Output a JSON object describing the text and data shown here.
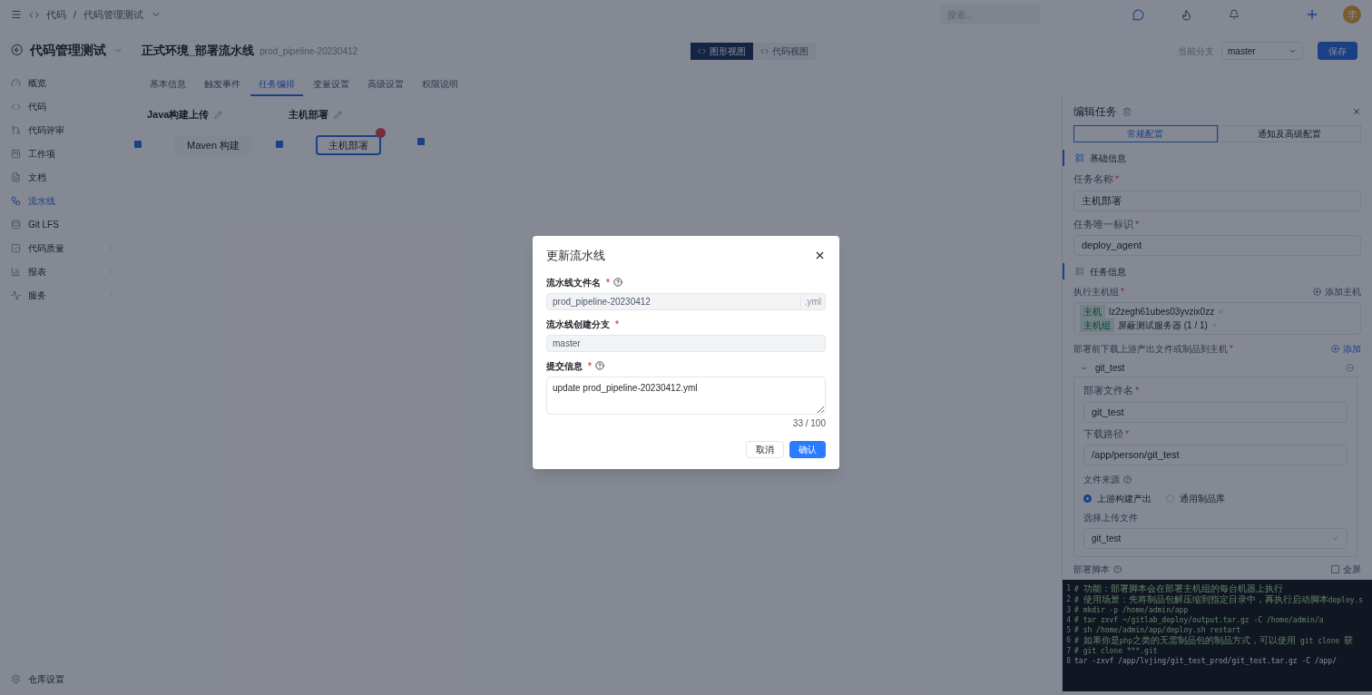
{
  "required_mark": "*",
  "topbar": {
    "breadcrumb": [
      "代码",
      "代码管理测试"
    ],
    "separator": "/",
    "search": {
      "placeholder": "搜索..."
    },
    "avatar": "李"
  },
  "sidebar": {
    "title": "代码管理测试",
    "items": [
      {
        "label": "概览",
        "kind": "overview",
        "selected": false,
        "expandable": false
      },
      {
        "label": "代码",
        "kind": "code",
        "selected": false,
        "expandable": false
      },
      {
        "label": "代码评审",
        "kind": "review",
        "selected": false,
        "expandable": false
      },
      {
        "label": "工作项",
        "kind": "work",
        "selected": false,
        "expandable": false
      },
      {
        "label": "文档",
        "kind": "doc",
        "selected": false,
        "expandable": false
      },
      {
        "label": "流水线",
        "kind": "pipeline",
        "selected": true,
        "expandable": false
      },
      {
        "label": "Git LFS",
        "kind": "lfs",
        "selected": false,
        "expandable": false
      },
      {
        "label": "代码质量",
        "kind": "quality",
        "selected": false,
        "expandable": true
      },
      {
        "label": "报表",
        "kind": "report",
        "selected": false,
        "expandable": true
      },
      {
        "label": "服务",
        "kind": "service",
        "selected": false,
        "expandable": true
      }
    ],
    "footer": "仓库设置"
  },
  "header": {
    "title": "正式环境_部署流水线",
    "subtitle": "prod_pipeline-20230412",
    "views": [
      {
        "label": "图形视图",
        "selected": true
      },
      {
        "label": "代码视图",
        "selected": false
      }
    ],
    "branch_label": "当前分支",
    "branch": "master",
    "save": "保存"
  },
  "tabs": [
    {
      "label": "基本信息",
      "selected": false
    },
    {
      "label": "触发事件",
      "selected": false
    },
    {
      "label": "任务编排",
      "selected": true
    },
    {
      "label": "变量设置",
      "selected": false
    },
    {
      "label": "高级设置",
      "selected": false
    },
    {
      "label": "权限说明",
      "selected": false
    }
  ],
  "stages": [
    {
      "title": "Java构建上传",
      "job": "Maven 构建",
      "selected": false,
      "error": false
    },
    {
      "title": "主机部署",
      "job": "主机部署",
      "selected": true,
      "error": true
    }
  ],
  "panel": {
    "title": "编辑任务",
    "tabs": [
      {
        "label": "常规配置",
        "selected": true
      },
      {
        "label": "通知及高级配置",
        "selected": false
      }
    ],
    "basic": {
      "heading": "基础信息",
      "name_label": "任务名称",
      "name": "主机部署",
      "id_label": "任务唯一标识",
      "id": "deploy_agent"
    },
    "task": {
      "heading": "任务信息",
      "hosts_label": "执行主机组",
      "add_host": "添加主机",
      "hosts": [
        {
          "tag": "主机",
          "text": "lz2zegh61ubes03yvzix0zz"
        },
        {
          "tag": "主机组",
          "text": "屏蔽测试服务器 (1 / 1)"
        }
      ],
      "download_label": "部署前下载上游产出文件或制品到主机",
      "add": "添加",
      "artifact": {
        "name": "git_test",
        "expanded": true,
        "file_label": "部署文件名",
        "file": "git_test",
        "path_label": "下载路径",
        "path": "/app/person/git_test",
        "source_label": "文件来源",
        "sources": [
          {
            "label": "上游构建产出",
            "selected": true
          },
          {
            "label": "通用制品库",
            "selected": false
          }
        ],
        "upload_label": "选择上传文件",
        "upload": "git_test"
      },
      "script_label": "部署脚本",
      "fullscreen": {
        "label": "全屏",
        "checked": false
      },
      "script": [
        {
          "no": "1",
          "text": "# 功能：部署脚本会在部署主机组的每台机器上执行"
        },
        {
          "no": "2",
          "text": "# 使用场景：先将制品包解压缩到指定目录中，再执行启动脚本deploy.s"
        },
        {
          "no": "3",
          "text": "# mkdir -p /home/admin/app"
        },
        {
          "no": "4",
          "text": "# tar zxvf ~/gitlab_deploy/output.tar.gz -C /home/admin/a"
        },
        {
          "no": "5",
          "text": "# sh /home/admin/app/deploy.sh restart"
        },
        {
          "no": "6",
          "text": "# 如果你是php之类的无需制品包的制品方式，可以使用 git clone 获"
        },
        {
          "no": "7",
          "text": "# git clone ***.git"
        },
        {
          "no": "8",
          "text": "tar -zxvf /app/lvjing/git_test_prod/git_test.tar.gz -C /app/"
        }
      ]
    }
  },
  "dialog": {
    "title": "更新流水线",
    "file_label": "流水线文件名",
    "file": "prod_pipeline-20230412",
    "suffix": ".yml",
    "branch_label": "流水线创建分支",
    "branch": "master",
    "message_label": "提交信息",
    "message": "update prod_pipeline-20230412.yml",
    "count": "33 / 100",
    "cancel": "取消",
    "confirm": "确认"
  }
}
